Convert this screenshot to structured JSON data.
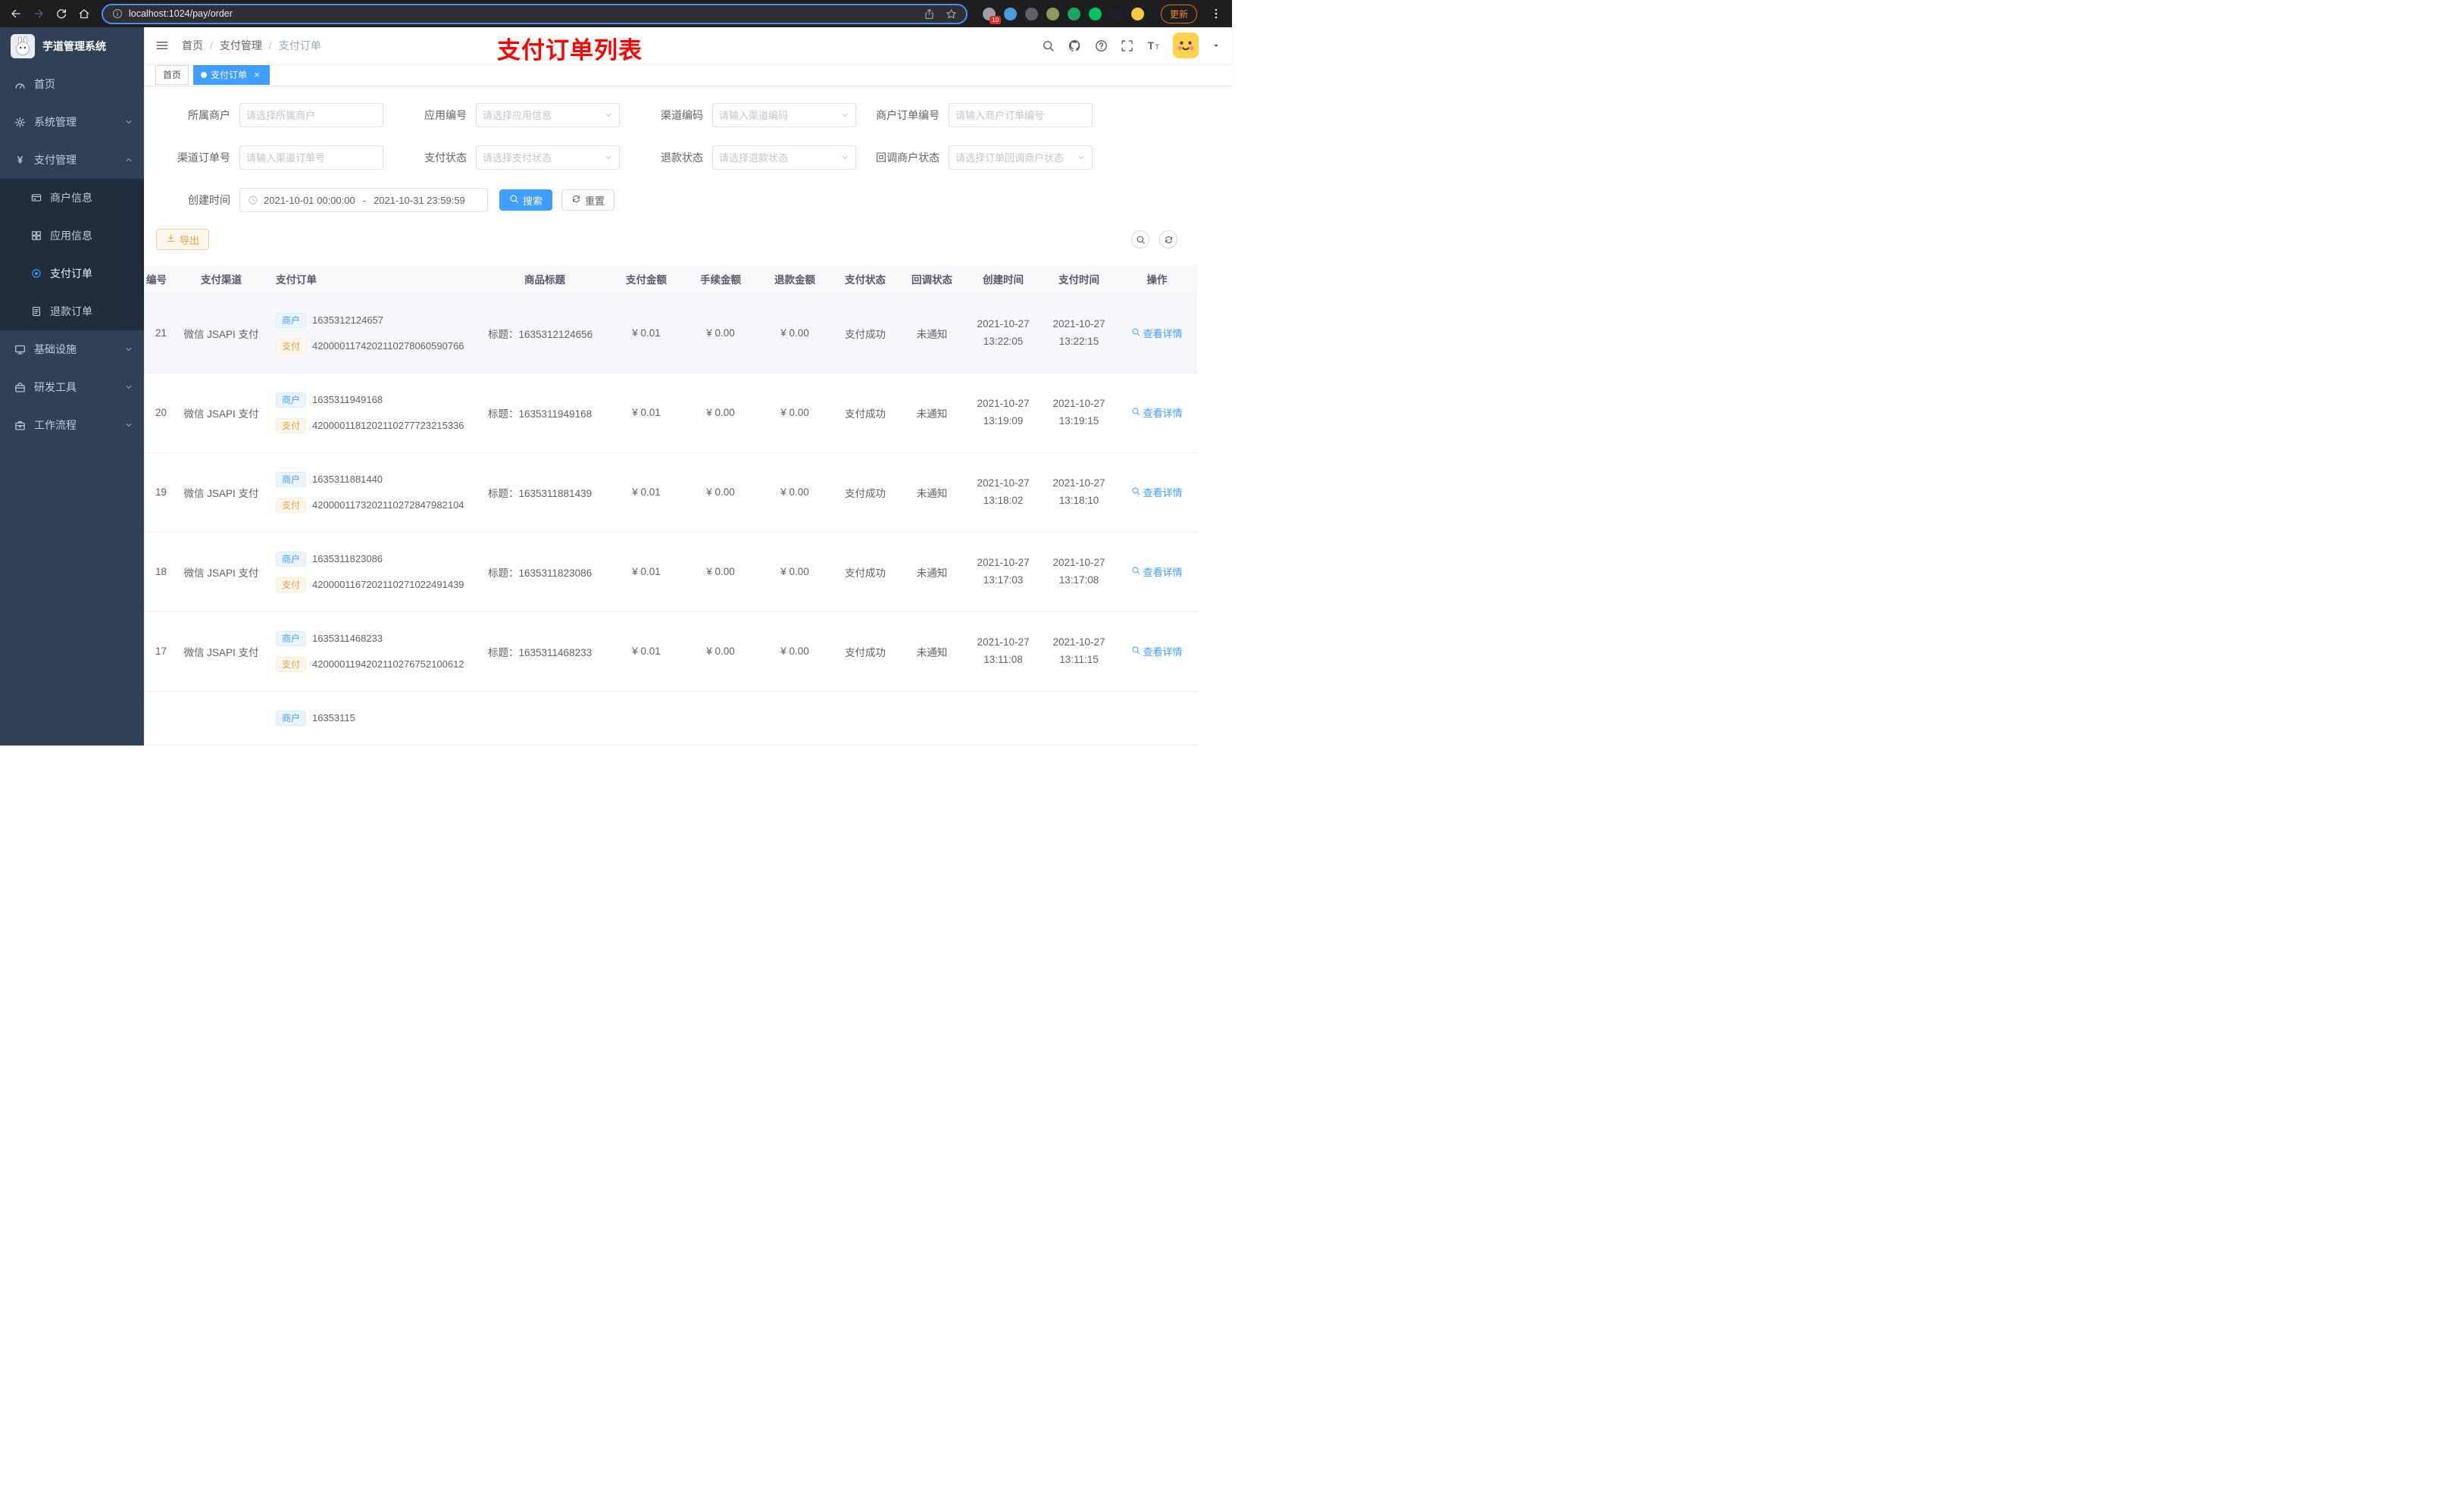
{
  "browser": {
    "url": "localhost:1024/pay/order",
    "update_label": "更新",
    "extensions": [
      {
        "name": "extension-1",
        "color": "#9aa0a6",
        "badge": "10"
      },
      {
        "name": "extension-2",
        "color": "#4a9bd9"
      },
      {
        "name": "extension-3",
        "color": "#5f6368"
      },
      {
        "name": "extension-4",
        "color": "#8a9a5b"
      },
      {
        "name": "extension-5",
        "color": "#21a366"
      },
      {
        "name": "extension-6",
        "color": "#07c160"
      },
      {
        "name": "extension-7",
        "color": "#202124"
      },
      {
        "name": "extension-8",
        "color": "#f7c948"
      }
    ]
  },
  "annotation": "支付订单列表",
  "sidebar": {
    "logo_title": "芋道管理系统",
    "items": [
      {
        "key": "home",
        "label": "首页",
        "icon": "dashboard"
      },
      {
        "key": "system",
        "label": "系统管理",
        "icon": "gear",
        "group": true
      },
      {
        "key": "pay",
        "label": "支付管理",
        "icon": "yen",
        "group": true,
        "expanded": true,
        "children": [
          {
            "key": "merchant-info",
            "label": "商户信息",
            "icon": "card"
          },
          {
            "key": "app-info",
            "label": "应用信息",
            "icon": "grid"
          },
          {
            "key": "pay-order",
            "label": "支付订单",
            "icon": "target",
            "active": true
          },
          {
            "key": "refund-order",
            "label": "退款订单",
            "icon": "doc"
          }
        ]
      },
      {
        "key": "infra",
        "label": "基础设施",
        "icon": "monitor",
        "group": true
      },
      {
        "key": "devtool",
        "label": "研发工具",
        "icon": "toolbox",
        "group": true
      },
      {
        "key": "workflow",
        "label": "工作流程",
        "icon": "briefcase",
        "group": true
      }
    ]
  },
  "breadcrumb": [
    "首页",
    "支付管理",
    "支付订单"
  ],
  "tabs": [
    {
      "label": "首页",
      "active": false
    },
    {
      "label": "支付订单",
      "active": true,
      "closable": true
    }
  ],
  "filters": {
    "fields": [
      {
        "label": "所属商户",
        "placeholder": "请选择所属商户",
        "type": "input"
      },
      {
        "label": "应用编号",
        "placeholder": "请选择应用信息",
        "type": "select"
      },
      {
        "label": "渠道编码",
        "placeholder": "请输入渠道编码",
        "type": "select"
      },
      {
        "label": "商户订单编号",
        "placeholder": "请输入商户订单编号",
        "type": "input"
      },
      {
        "label": "渠道订单号",
        "placeholder": "请输入渠道订单号",
        "type": "input"
      },
      {
        "label": "支付状态",
        "placeholder": "请选择支付状态",
        "type": "select"
      },
      {
        "label": "退款状态",
        "placeholder": "请选择退款状态",
        "type": "select"
      },
      {
        "label": "回调商户状态",
        "placeholder": "请选择订单回调商户状态",
        "type": "select"
      }
    ],
    "date": {
      "label": "创建时间",
      "start": "2021-10-01 00:00:00",
      "separator": "-",
      "end": "2021-10-31 23:59:59"
    },
    "search_label": "搜索",
    "reset_label": "重置"
  },
  "toolbar": {
    "export_label": "导出"
  },
  "table": {
    "columns": [
      "编号",
      "支付渠道",
      "支付订单",
      "商品标题",
      "支付金额",
      "手续金额",
      "退款金额",
      "支付状态",
      "回调状态",
      "创建时间",
      "支付时间",
      "操作"
    ],
    "tag_merchant": "商户",
    "tag_pay": "支付",
    "action_label": "查看详情",
    "rows": [
      {
        "id": "21",
        "channel": "微信 JSAPI 支付",
        "merchant_no": "1635312124657",
        "pay_no": "4200001174202110278060590766",
        "title": "标题：1635312124656",
        "amount": "¥ 0.01",
        "fee": "¥ 0.00",
        "refund": "¥ 0.00",
        "status": "支付成功",
        "notify": "未通知",
        "created": "2021-10-27 13:22:05",
        "paid": "2021-10-27 13:22:15",
        "highlighted": true
      },
      {
        "id": "20",
        "channel": "微信 JSAPI 支付",
        "merchant_no": "1635311949168",
        "pay_no": "4200001181202110277723215336",
        "title": "标题：1635311949168",
        "amount": "¥ 0.01",
        "fee": "¥ 0.00",
        "refund": "¥ 0.00",
        "status": "支付成功",
        "notify": "未通知",
        "created": "2021-10-27 13:19:09",
        "paid": "2021-10-27 13:19:15"
      },
      {
        "id": "19",
        "channel": "微信 JSAPI 支付",
        "merchant_no": "1635311881440",
        "pay_no": "4200001173202110272847982104",
        "title": "标题：1635311881439",
        "amount": "¥ 0.01",
        "fee": "¥ 0.00",
        "refund": "¥ 0.00",
        "status": "支付成功",
        "notify": "未通知",
        "created": "2021-10-27 13:18:02",
        "paid": "2021-10-27 13:18:10"
      },
      {
        "id": "18",
        "channel": "微信 JSAPI 支付",
        "merchant_no": "1635311823086",
        "pay_no": "4200001167202110271022491439",
        "title": "标题：1635311823086",
        "amount": "¥ 0.01",
        "fee": "¥ 0.00",
        "refund": "¥ 0.00",
        "status": "支付成功",
        "notify": "未通知",
        "created": "2021-10-27 13:17:03",
        "paid": "2021-10-27 13:17:08"
      },
      {
        "id": "17",
        "channel": "微信 JSAPI 支付",
        "merchant_no": "1635311468233",
        "pay_no": "4200001194202110276752100612",
        "title": "标题：1635311468233",
        "amount": "¥ 0.01",
        "fee": "¥ 0.00",
        "refund": "¥ 0.00",
        "status": "支付成功",
        "notify": "未通知",
        "created": "2021-10-27 13:11:08",
        "paid": "2021-10-27 13:11:15"
      },
      {
        "id": "",
        "channel": "",
        "merchant_no": "16353115",
        "pay_no": "",
        "title": "",
        "amount": "",
        "fee": "",
        "refund": "",
        "status": "",
        "notify": "",
        "created": "",
        "paid": "",
        "partial": true
      }
    ]
  },
  "colors": {
    "accent": "#409eff",
    "warning": "#e6a23c",
    "annotation": "#ff0000",
    "sidebar_bg": "#304156",
    "submenu_bg": "#1f2d3d"
  }
}
